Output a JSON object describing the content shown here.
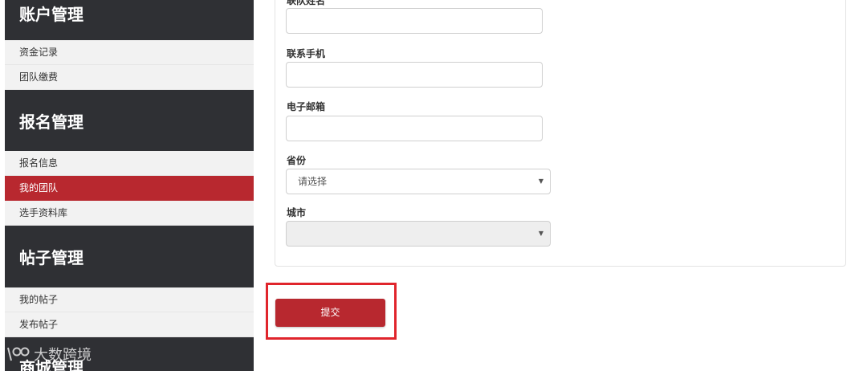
{
  "sidebar": {
    "sections": [
      {
        "title": "账户管理",
        "items": [
          "资金记录",
          "团队缴费"
        ]
      },
      {
        "title": "报名管理",
        "items": [
          "报名信息",
          "我的团队",
          "选手资料库"
        ]
      },
      {
        "title": "帖子管理",
        "items": [
          "我的帖子",
          "发布帖子"
        ]
      },
      {
        "title": "商城管理",
        "items": []
      }
    ],
    "active_item": "我的团队"
  },
  "form": {
    "top_label_partial": "联队姓名",
    "phone_label": "联系手机",
    "email_label": "电子邮箱",
    "province_label": "省份",
    "province_value": "请选择",
    "city_label": "城市",
    "city_value": ""
  },
  "submit_label": "提交",
  "watermark_text": "大数跨境",
  "colors": {
    "sidebar_header": "#2f3034",
    "accent": "#b8282f",
    "highlight": "#e0252c"
  }
}
